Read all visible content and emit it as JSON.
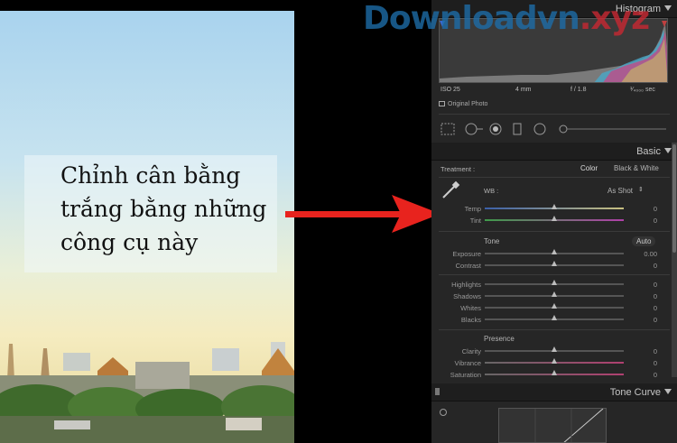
{
  "caption": {
    "line1": "Chỉnh cân bằng",
    "line2": "trắng bằng những",
    "line3": "công cụ này"
  },
  "watermark": {
    "main": "Downloadvn",
    "suffix": ".xyz"
  },
  "histogram": {
    "title": "Histogram",
    "iso": "ISO 25",
    "focal": "4 mm",
    "aperture": "f / 1.8",
    "shutter": "¹⁄₄₀₀₀ sec",
    "original_photo": "Original Photo"
  },
  "basic": {
    "title": "Basic",
    "treatment_label": "Treatment :",
    "color_label": "Color",
    "bw_label": "Black & White",
    "wb_label": "WB :",
    "wb_value": "As Shot",
    "tone_label": "Tone",
    "auto_label": "Auto",
    "presence_label": "Presence",
    "sliders": {
      "temp": {
        "label": "Temp",
        "value": "0"
      },
      "tint": {
        "label": "Tint",
        "value": "0"
      },
      "exposure": {
        "label": "Exposure",
        "value": "0.00"
      },
      "contrast": {
        "label": "Contrast",
        "value": "0"
      },
      "highlights": {
        "label": "Highlights",
        "value": "0"
      },
      "shadows": {
        "label": "Shadows",
        "value": "0"
      },
      "whites": {
        "label": "Whites",
        "value": "0"
      },
      "blacks": {
        "label": "Blacks",
        "value": "0"
      },
      "clarity": {
        "label": "Clarity",
        "value": "0"
      },
      "vibrance": {
        "label": "Vibrance",
        "value": "0"
      },
      "saturation": {
        "label": "Saturation",
        "value": "0"
      }
    }
  },
  "tone_curve": {
    "title": "Tone Curve"
  },
  "colors": {
    "arrow": "#e8231e",
    "panel": "#262626"
  }
}
